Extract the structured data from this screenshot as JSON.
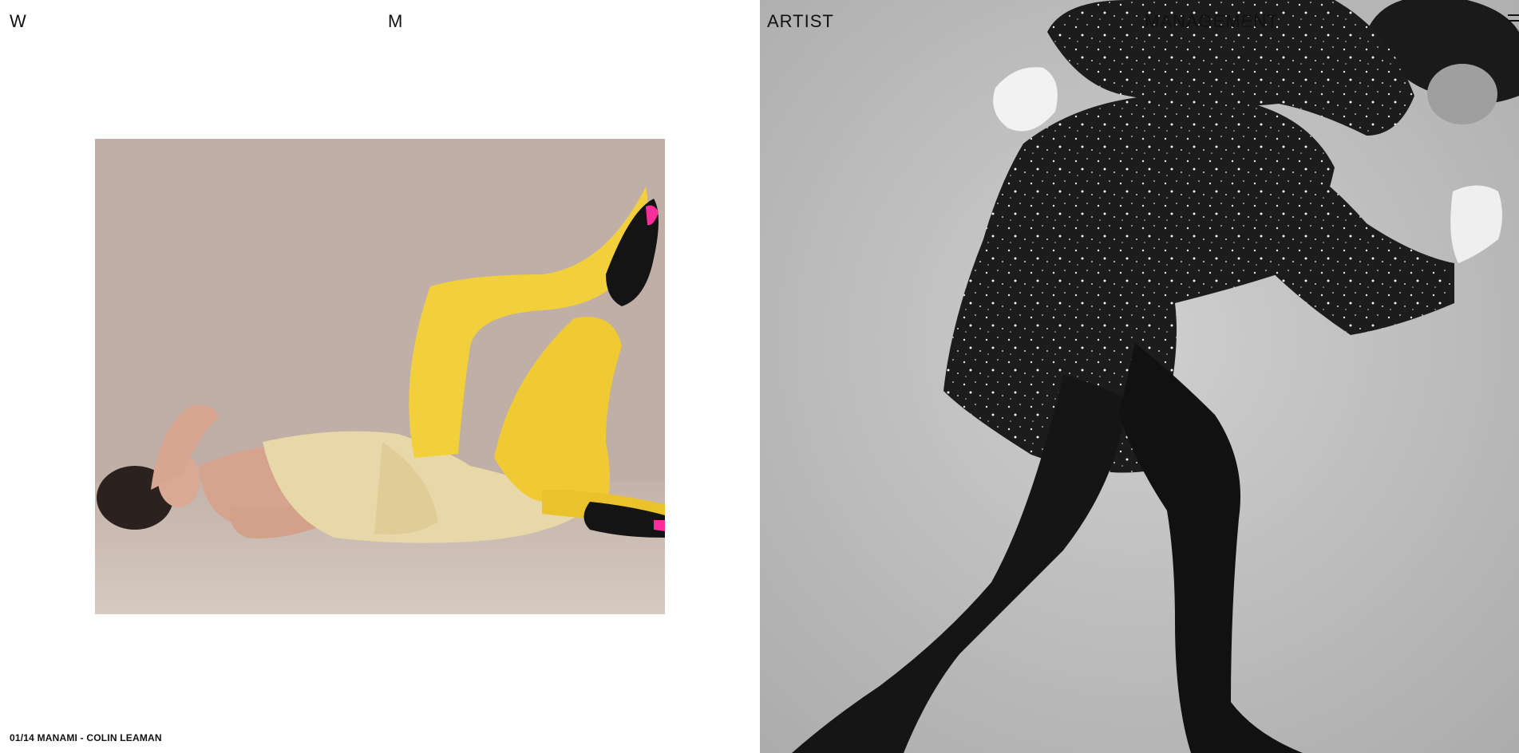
{
  "nav": {
    "letter_w": "W",
    "letter_m": "M",
    "artist": "ARTIST",
    "management": "MANAGEMENT"
  },
  "menu": {
    "icon": "hamburger-menu-icon"
  },
  "slide": {
    "caption": "01/14 MANAMI - COLIN LEAMAN"
  },
  "colors": {
    "background": "#ffffff",
    "text": "#111111",
    "tights_yellow": "#f2d03b",
    "dress_cream": "#e9d9a8",
    "shoe_pink": "#ff2d9a"
  }
}
